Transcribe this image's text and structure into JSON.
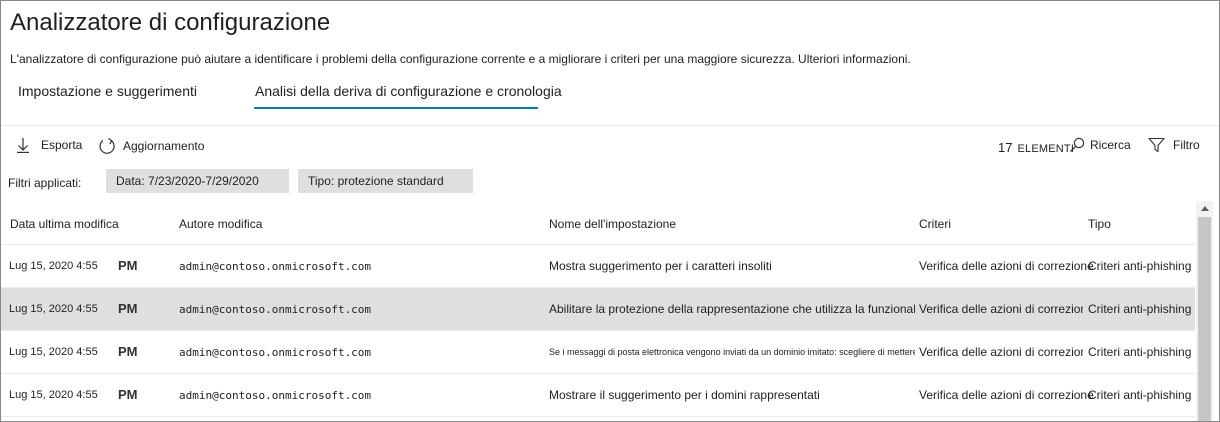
{
  "page": {
    "title": "Analizzatore di configurazione",
    "description": "L'analizzatore di configurazione può aiutare a identificare i problemi della configurazione corrente e a migliorare i criteri per una maggiore sicurezza. Ulteriori informazioni."
  },
  "tabs": [
    {
      "label": "Impostazione e suggerimenti",
      "selected": false
    },
    {
      "label": "Analisi della deriva di configurazione e cronologia",
      "selected": true
    }
  ],
  "accent_color": "#0078d4",
  "toolbar": {
    "export_label": "Esporta",
    "export_icon": "download-icon",
    "refresh_label": "Aggiornamento",
    "refresh_icon": "refresh-icon",
    "item_count": "17",
    "item_count_label": "ELEMENTI",
    "search_label": "Ricerca",
    "search_icon": "search-icon",
    "filter_label": "Filtro",
    "filter_icon": "filter-icon"
  },
  "filters": {
    "label": "Filtri applicati:",
    "chips": [
      "Data: 7/23/2020-7/29/2020",
      "Tipo: protezione standard"
    ]
  },
  "table": {
    "columns": [
      "Data ultima modifica",
      "Autore modifica",
      "Nome dell'impostazione",
      "Criteri",
      "Tipo"
    ],
    "rows": [
      {
        "date": "Lug 15, 2020 4:55",
        "ampm": "PM",
        "author": "admin@contoso.onmicrosoft.com",
        "setting": "Mostra suggerimento per i caratteri insoliti",
        "policy": "Verifica delle azioni di correzione",
        "type": "Criteri anti-phishing",
        "selected": false
      },
      {
        "date": "Lug 15, 2020 4:55",
        "ampm": "PM",
        "author": "admin@contoso.onmicrosoft.com",
        "setting": "Abilitare la protezione della rappresentazione che utilizza la funzionalità di intelligence delle cassette postali",
        "policy": "Verifica delle azioni di correzione",
        "type": "Criteri anti-phishing",
        "selected": true
      },
      {
        "date": "Lug 15, 2020 4:55",
        "ampm": "PM",
        "author": "admin@contoso.onmicrosoft.com",
        "setting": "Se i messaggi di posta elettronica vengono inviati da un dominio imitato: scegliere di mettere in quarantena il messaggio",
        "policy": "Verifica delle azioni di correzione",
        "type": "Criteri anti-phishing",
        "selected": false
      },
      {
        "date": "Lug 15, 2020 4:55",
        "ampm": "PM",
        "author": "admin@contoso.onmicrosoft.com",
        "setting": "Mostrare il suggerimento per i domini rappresentati",
        "policy": "Verifica delle azioni di correzione",
        "type": "Criteri anti-phishing",
        "selected": false
      }
    ]
  }
}
